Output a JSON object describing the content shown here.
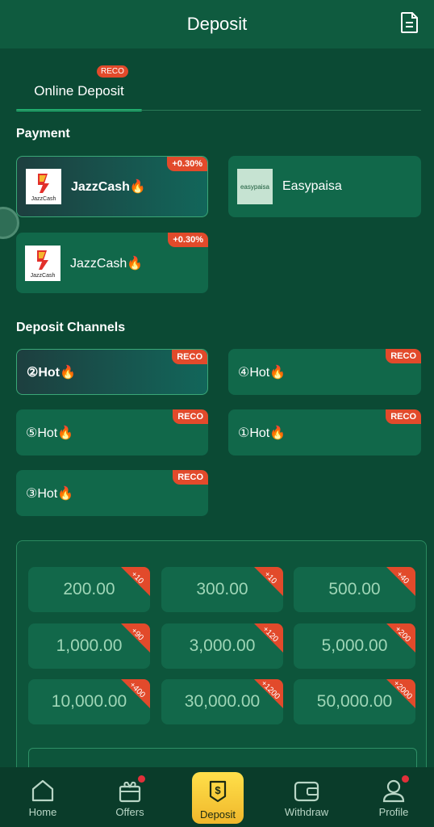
{
  "header": {
    "title": "Deposit",
    "records_icon": "document-icon"
  },
  "tabs": [
    {
      "label": "Online Deposit",
      "badge": "RECO",
      "active": true
    }
  ],
  "payment": {
    "title": "Payment",
    "methods": [
      {
        "label": "JazzCash🔥",
        "badge": "+0.30%",
        "logo_text": "JazzCash",
        "selected": true
      },
      {
        "label": "Easypaisa",
        "logo_text": "easypaisa",
        "selected": false
      },
      {
        "label": "JazzCash🔥",
        "badge": "+0.30%",
        "logo_text": "JazzCash",
        "selected": false
      }
    ]
  },
  "channels": {
    "title": "Deposit Channels",
    "items": [
      {
        "label": "②Hot🔥",
        "badge": "RECO",
        "selected": true
      },
      {
        "label": "④Hot🔥",
        "badge": "RECO",
        "selected": false
      },
      {
        "label": "⑤Hot🔥",
        "badge": "RECO",
        "selected": false
      },
      {
        "label": "①Hot🔥",
        "badge": "RECO",
        "selected": false
      },
      {
        "label": "③Hot🔥",
        "badge": "RECO",
        "selected": false
      }
    ]
  },
  "amounts": [
    {
      "value": "200.00",
      "bonus": "+10"
    },
    {
      "value": "300.00",
      "bonus": "+10"
    },
    {
      "value": "500.00",
      "bonus": "+40"
    },
    {
      "value": "1,000.00",
      "bonus": "+90"
    },
    {
      "value": "3,000.00",
      "bonus": "+120"
    },
    {
      "value": "5,000.00",
      "bonus": "+200"
    },
    {
      "value": "10,000.00",
      "bonus": "+400"
    },
    {
      "value": "30,000.00",
      "bonus": "+1200"
    },
    {
      "value": "50,000.00",
      "bonus": "+2000"
    }
  ],
  "nav": {
    "home": "Home",
    "offers": "Offers",
    "deposit": "Deposit",
    "withdraw": "Withdraw",
    "profile": "Profile"
  },
  "colors": {
    "background": "#0b4a34",
    "card": "#11684a",
    "accent_badge": "#e24a2b",
    "deposit_button": "#f0b72b"
  }
}
